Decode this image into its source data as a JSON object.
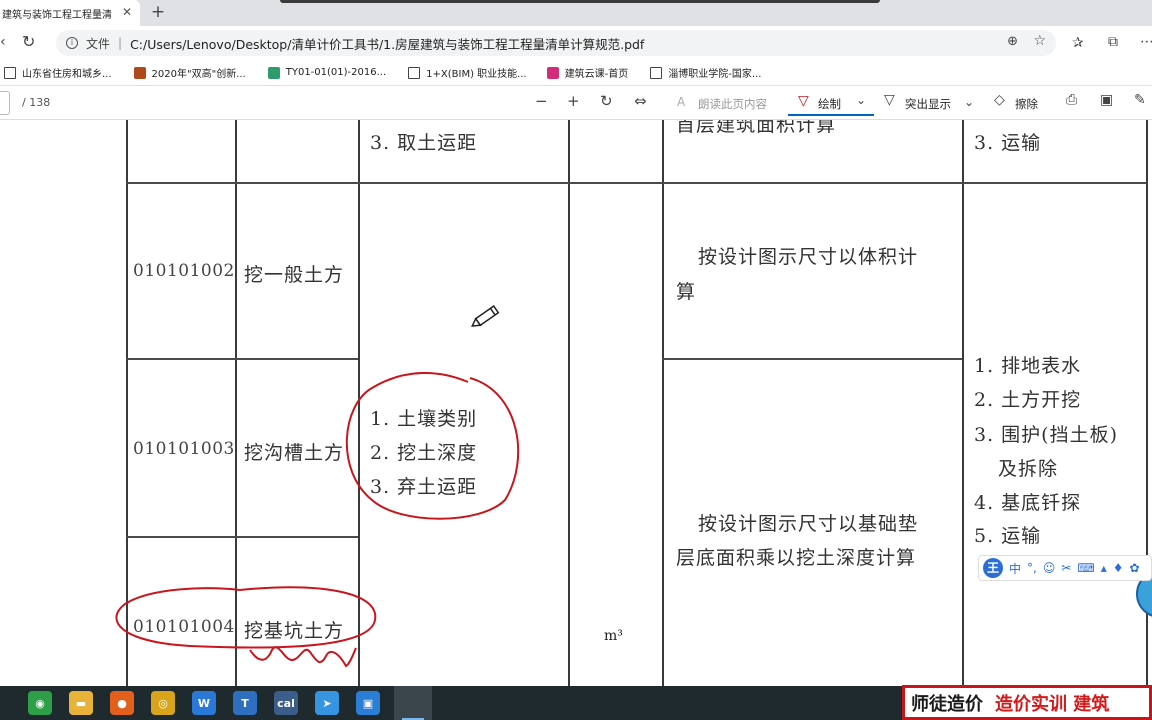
{
  "browser": {
    "tab_title": "建筑与装饰工程工程量清",
    "tab_close": "✕",
    "new_tab": "+",
    "address_label": "文件",
    "separator": "|",
    "url": "C:/Users/Lenovo/Desktop/清单计价工具书/1.房屋建筑与装饰工程工程量清单计算规范.pdf"
  },
  "bookmarks": [
    {
      "label": "山东省住房和城乡...",
      "icon_color": "#222222"
    },
    {
      "label": "2020年\"双高\"创新...",
      "icon_color": "#b04a1a"
    },
    {
      "label": "TY01-01(01)-2016...",
      "icon_color": "#2f9a6b"
    },
    {
      "label": "1+X(BIM) 职业技能...",
      "icon_color": "#555555"
    },
    {
      "label": "建筑云课-首页",
      "icon_color": "#d12d7a"
    },
    {
      "label": "淄博职业学院-国家...",
      "icon_color": "#555555"
    }
  ],
  "pdf_toolbar": {
    "page_total": "/ 138",
    "read_aloud": "朗读此页内容",
    "draw": "绘制",
    "highlight": "突出显示",
    "erase": "擦除"
  },
  "table": {
    "row_top": {
      "features": "3. 取土运距",
      "rule": "首层建筑面积计算",
      "work": "3. 运输"
    },
    "rows": [
      {
        "code": "010101002",
        "name": "挖一般土方"
      },
      {
        "code": "010101003",
        "name": "挖沟槽土方"
      },
      {
        "code": "010101004",
        "name": "挖基坑土方"
      }
    ],
    "features": [
      "1. 土壤类别",
      "2. 挖土深度",
      "3. 弃土运距"
    ],
    "unit": "m³",
    "rule_1": [
      "按设计图示尺寸以体积计",
      "算"
    ],
    "rule_2": [
      "按设计图示尺寸以基础垫",
      "层底面积乘以挖土深度计算"
    ],
    "work_items": [
      "1. 排地表水",
      "2. 土方开挖",
      "3. 围护(挡土板)",
      "及拆除",
      "4. 基底钎探",
      "5. 运输"
    ]
  },
  "ime": {
    "logo": "王",
    "lang": "中"
  },
  "banner": {
    "part1": "师徒造价",
    "part2": "造价实训  建筑"
  },
  "taskbar": [
    {
      "name": "edge-green",
      "color": "#2e9f48",
      "glyph": "◉"
    },
    {
      "name": "file-explorer",
      "color": "#e8b339",
      "glyph": "▬"
    },
    {
      "name": "firefox",
      "color": "#e2601c",
      "glyph": "●"
    },
    {
      "name": "chrome",
      "color": "#d9a31c",
      "glyph": "◎"
    },
    {
      "name": "wps",
      "color": "#2b79d6",
      "glyph": "W"
    },
    {
      "name": "word-t",
      "color": "#2f6fc0",
      "glyph": "T"
    },
    {
      "name": "calc-app",
      "color": "#3b5d8a",
      "glyph": "cal"
    },
    {
      "name": "feather-app",
      "color": "#3794e0",
      "glyph": "➤"
    },
    {
      "name": "capture-app",
      "color": "#2b7ed6",
      "glyph": "▣"
    },
    {
      "name": "edge",
      "color": "#1d8bd2",
      "glyph": "e"
    }
  ],
  "colors": {
    "annotation": "#c8161d",
    "accent": "#0067c0"
  }
}
